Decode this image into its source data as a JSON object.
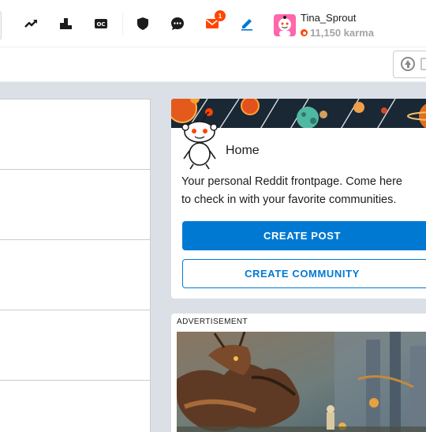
{
  "header": {
    "icons": [
      "trending-icon",
      "leaderboard-icon",
      "original-content-icon",
      "shield-icon",
      "chat-icon",
      "mail-icon",
      "pencil-icon"
    ],
    "mail_badge": "1",
    "user": {
      "name": "Tina_Sprout",
      "karma": "11,150 karma"
    }
  },
  "home_card": {
    "title": "Home",
    "description_line1": "Your personal Reddit frontpage. Come here",
    "description_line2": "to check in with your favorite communities.",
    "create_post": "CREATE POST",
    "create_community": "CREATE COMMUNITY"
  },
  "ad": {
    "label": "ADVERTISEMENT"
  },
  "colors": {
    "accent": "#0079d3",
    "brand": "#ff4500",
    "background": "#dae0e6"
  }
}
